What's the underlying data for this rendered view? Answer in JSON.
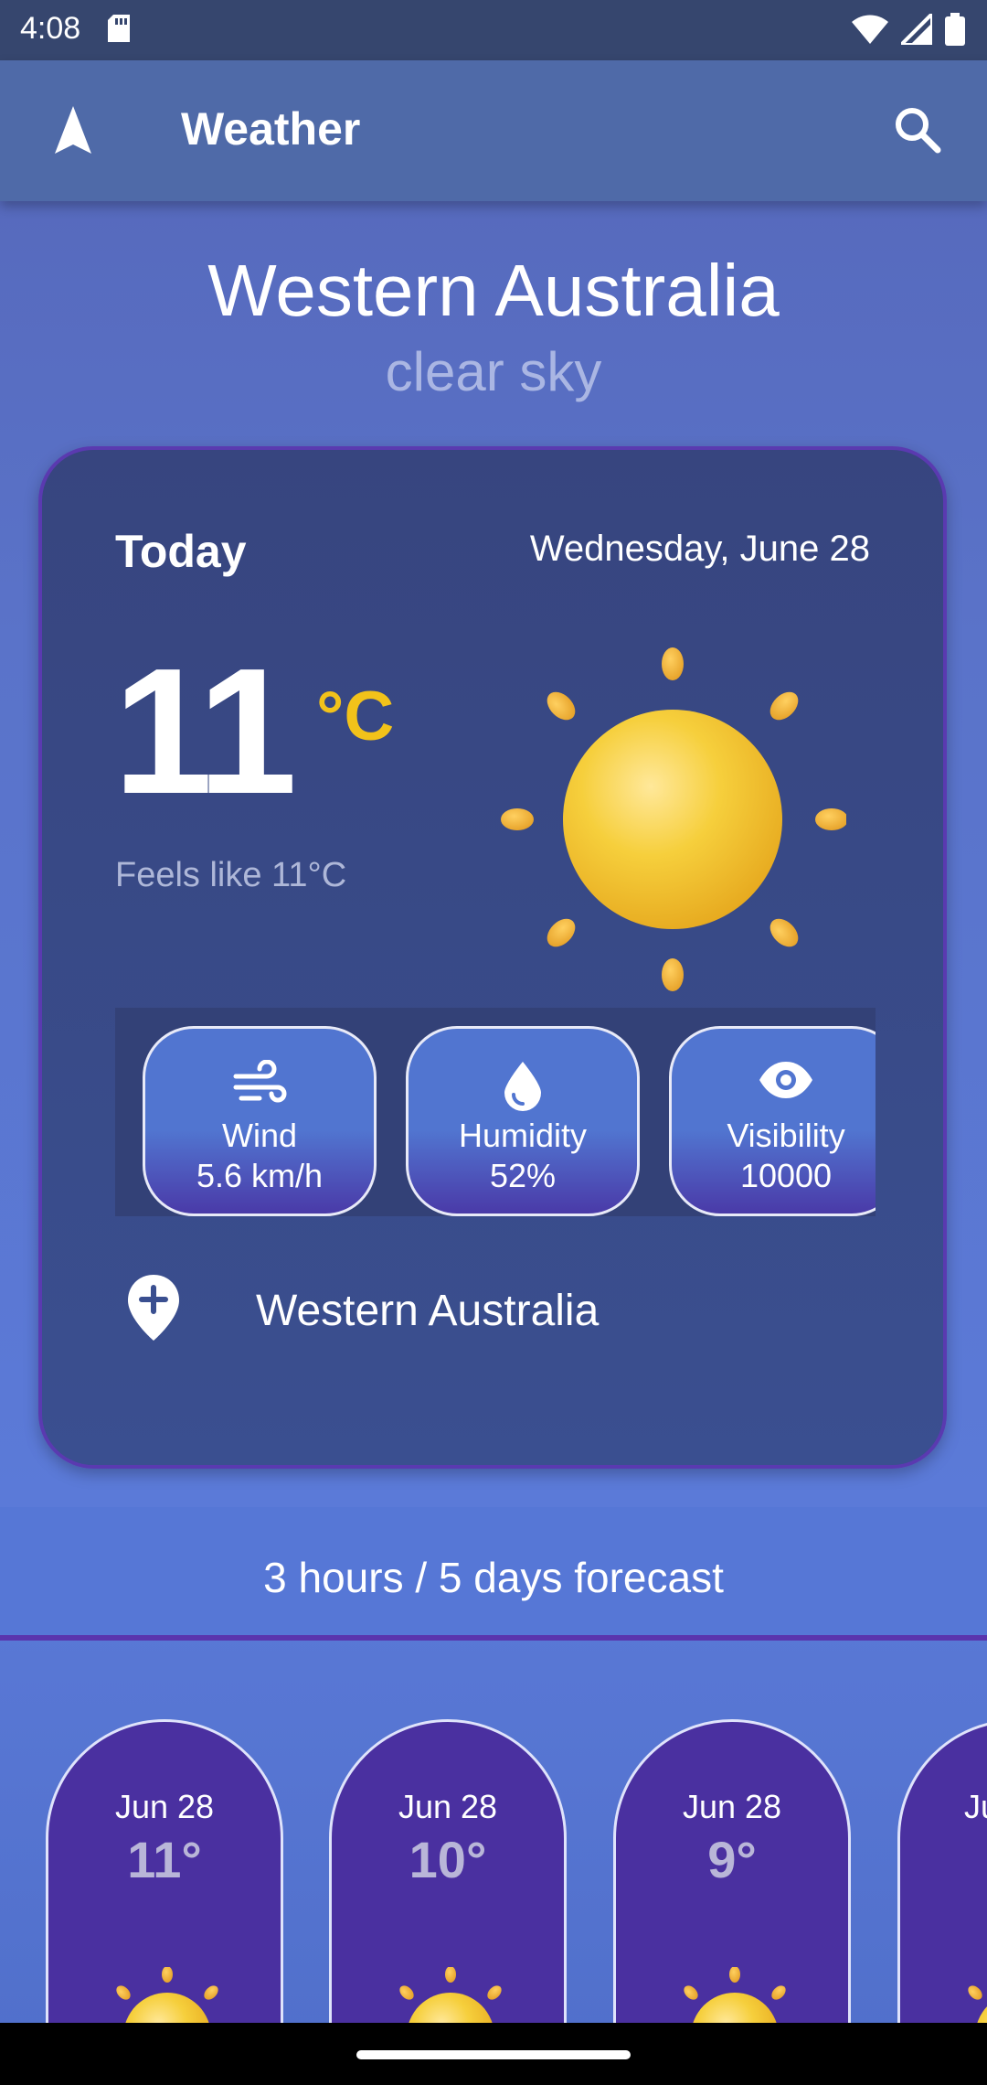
{
  "status_bar": {
    "time": "4:08"
  },
  "app_bar": {
    "title": "Weather"
  },
  "header": {
    "location": "Western Australia",
    "condition": "clear sky"
  },
  "today": {
    "label": "Today",
    "date": "Wednesday, June 28",
    "temperature": "11",
    "unit": "°C",
    "feels_like": "Feels like 11°C",
    "stats": [
      {
        "label": "Wind",
        "value": "5.6 km/h",
        "icon": "wind-icon"
      },
      {
        "label": "Humidity",
        "value": "52%",
        "icon": "water-drop-icon"
      },
      {
        "label": "Visibility",
        "value": "10000",
        "icon": "eye-icon"
      }
    ],
    "location": "Western Australia"
  },
  "forecast": {
    "title": "3 hours / 5 days forecast",
    "items": [
      {
        "date": "Jun 28",
        "temp": "11°"
      },
      {
        "date": "Jun 28",
        "temp": "10°"
      },
      {
        "date": "Jun 28",
        "temp": "9°"
      },
      {
        "date": "Ju",
        "temp": ""
      }
    ]
  },
  "colors": {
    "accent_unit": "#f2c21a",
    "card_border": "#5a3ab0",
    "forecast_card": "#4a30a0"
  }
}
